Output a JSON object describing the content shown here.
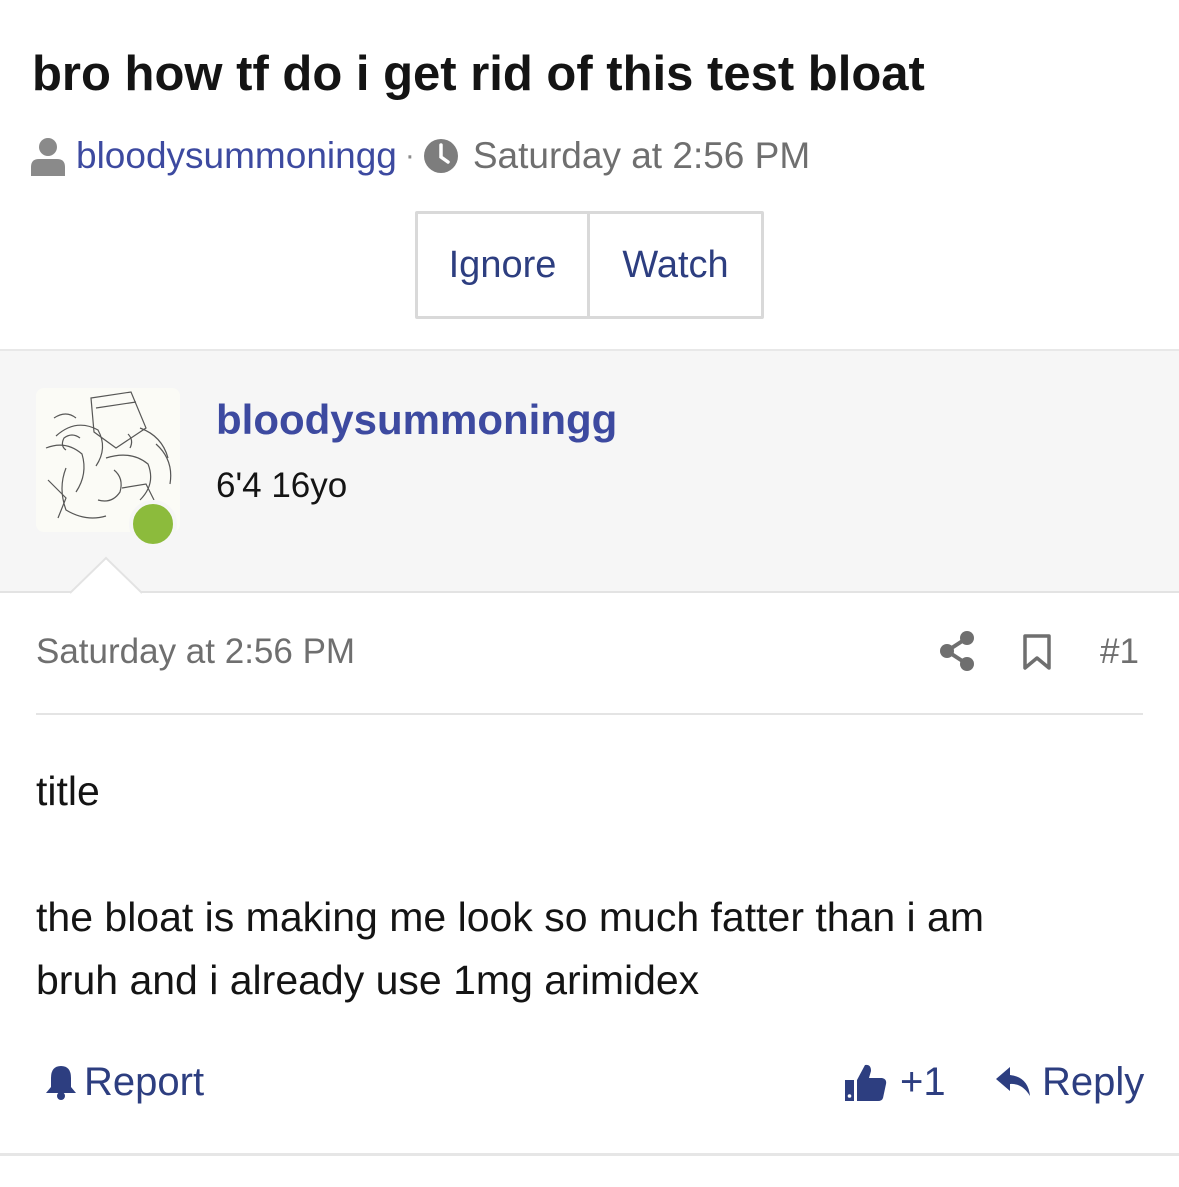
{
  "thread": {
    "title": "bro how tf do i get rid of this test bloat",
    "author": "bloodysummoningg",
    "separator": "·",
    "date": "Saturday at 2:56 PM"
  },
  "thread_actions": {
    "ignore_label": "Ignore",
    "watch_label": "Watch"
  },
  "post": {
    "username": "bloodysummoningg",
    "user_title": "6'4 16yo",
    "online": true,
    "date": "Saturday at 2:56 PM",
    "number": "#1",
    "body": [
      "title",
      "",
      "the bloat is making me look so much fatter than i am",
      "bruh and i already use 1mg arimidex"
    ],
    "report_label": "Report",
    "like_count": "+1",
    "reply_label": "Reply"
  },
  "icons": {
    "user": "user-icon",
    "clock": "clock-icon",
    "share": "share-icon",
    "bookmark": "bookmark-icon",
    "bell": "bell-icon",
    "thumb": "thumbs-up-icon",
    "reply": "reply-arrow-icon"
  },
  "colors": {
    "link": "#3d4aa0",
    "button_text": "#2d3e80",
    "muted": "#6f6f6f",
    "online": "#8cbb3c",
    "panel_bg": "#f6f6f6"
  }
}
